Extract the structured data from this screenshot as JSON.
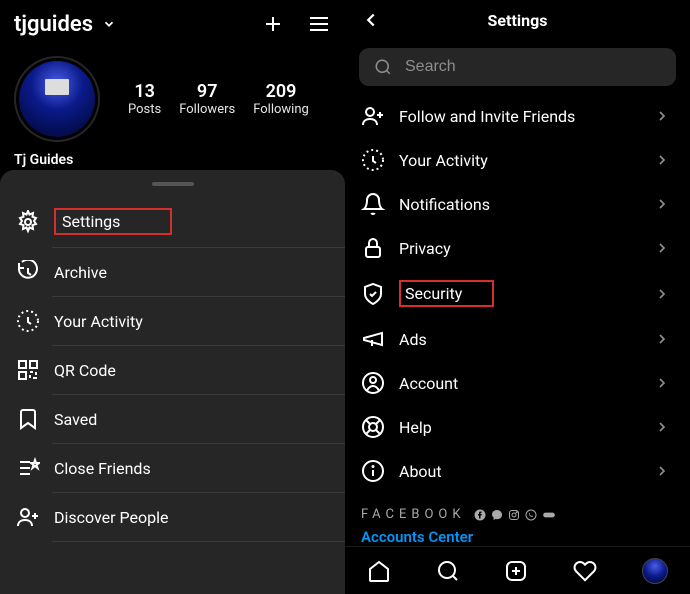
{
  "left": {
    "username": "tjguides",
    "stats": {
      "posts": {
        "number": "13",
        "label": "Posts"
      },
      "followers": {
        "number": "97",
        "label": "Followers"
      },
      "following": {
        "number": "209",
        "label": "Following"
      }
    },
    "display_name": "Tj Guides",
    "menu": [
      {
        "label": "Settings",
        "icon": "gear"
      },
      {
        "label": "Archive",
        "icon": "archive"
      },
      {
        "label": "Your Activity",
        "icon": "activity"
      },
      {
        "label": "QR Code",
        "icon": "qr"
      },
      {
        "label": "Saved",
        "icon": "bookmark"
      },
      {
        "label": "Close Friends",
        "icon": "close-friends"
      },
      {
        "label": "Discover People",
        "icon": "discover"
      }
    ]
  },
  "right": {
    "title": "Settings",
    "search_placeholder": "Search",
    "items": [
      {
        "label": "Follow and Invite Friends",
        "icon": "follow"
      },
      {
        "label": "Your Activity",
        "icon": "activity"
      },
      {
        "label": "Notifications",
        "icon": "bell"
      },
      {
        "label": "Privacy",
        "icon": "lock"
      },
      {
        "label": "Security",
        "icon": "shield"
      },
      {
        "label": "Ads",
        "icon": "ads"
      },
      {
        "label": "Account",
        "icon": "account"
      },
      {
        "label": "Help",
        "icon": "help"
      },
      {
        "label": "About",
        "icon": "info"
      }
    ],
    "brand": "FACEBOOK",
    "accounts_center": "Accounts Center"
  }
}
